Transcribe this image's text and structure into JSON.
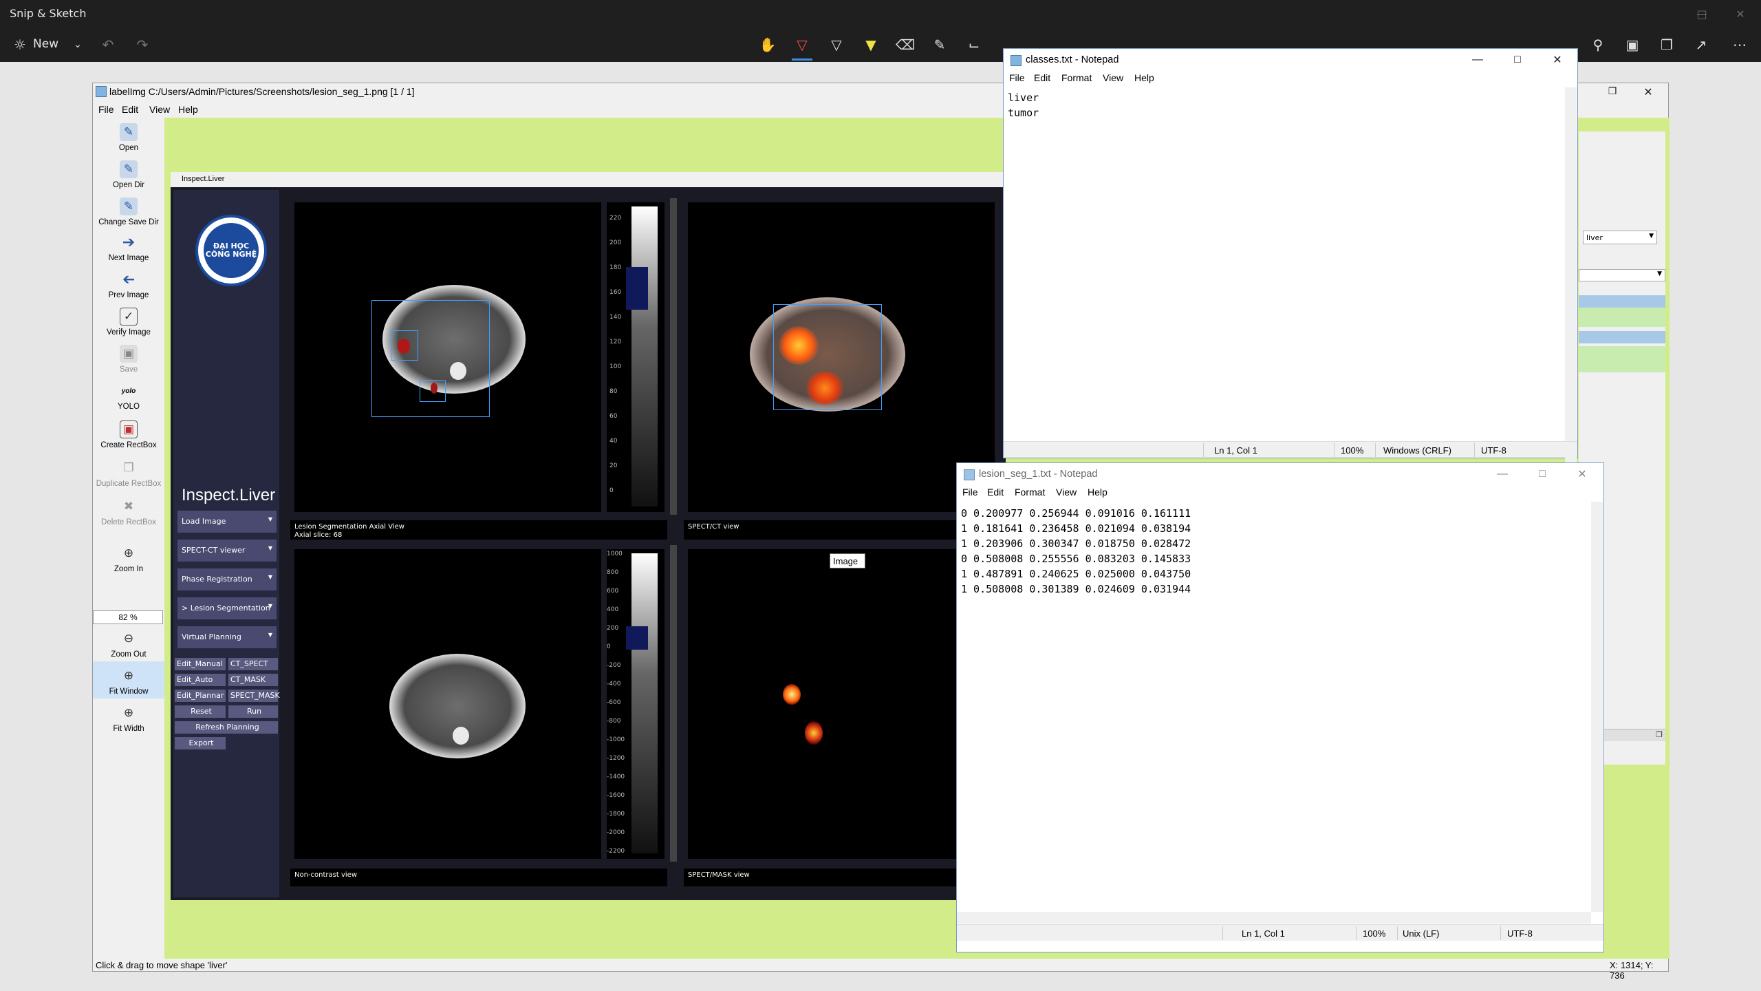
{
  "snip": {
    "title": "Snip & Sketch",
    "new_label": "New"
  },
  "labelimg": {
    "title": "labelImg C:/Users/Admin/Pictures/Screenshots/lesion_seg_1.png [1 / 1]",
    "menu": [
      "File",
      "Edit",
      "View",
      "Help"
    ],
    "tools": {
      "open": "Open",
      "open_dir": "Open Dir",
      "change_save_dir": "Change Save Dir",
      "next_image": "Next Image",
      "prev_image": "Prev Image",
      "verify_image": "Verify Image",
      "save": "Save",
      "yolo_icon": "yolo",
      "yolo": "YOLO",
      "create_rectbox": "Create RectBox",
      "duplicate_rectbox": "Duplicate RectBox",
      "delete_rectbox": "Delete RectBox",
      "zoom_in": "Zoom In",
      "zoom_value": "82 %",
      "zoom_out": "Zoom Out",
      "fit_window": "Fit Window",
      "fit_width": "Fit Width"
    },
    "status_left": "Click & drag to move shape 'liver'",
    "status_right": "X: 1314; Y: 736",
    "label_combo": "liver",
    "tooltip": "Image"
  },
  "inspect": {
    "window_title": "Inspect.Liver",
    "app_title": "Inspect.Liver",
    "logo_text": "ĐẠI HỌC CÔNG NGHỆ",
    "menu": [
      {
        "label": "Load Image"
      },
      {
        "label": "SPECT-CT viewer"
      },
      {
        "label": "Phase Registration"
      },
      {
        "label": "> Lesion Segmentation"
      },
      {
        "label": "Virtual Planning"
      }
    ],
    "buttons": {
      "edit_manual": "Edit_Manual",
      "ct_spect": "CT_SPECT",
      "edit_auto": "Edit_Auto",
      "ct_mask": "CT_MASK",
      "edit_plannar": "Edit_Plannar",
      "spect_mask": "SPECT_MASK",
      "reset": "Reset",
      "run": "Run",
      "refresh_planning": "Refresh Planning",
      "export": "Export"
    },
    "captions": {
      "axial": "Lesion Segmentation Axial View",
      "axial_slice": "Axial slice: 68",
      "spect_ct": "SPECT/CT view",
      "non_contrast": "Non-contrast view",
      "spect_mask": "SPECT/MASK view"
    },
    "scale_top": [
      "220",
      "200",
      "180",
      "160",
      "140",
      "120",
      "100",
      "80",
      "60",
      "40",
      "20",
      "0"
    ],
    "scale_bottom": [
      "1000",
      "800",
      "600",
      "400",
      "200",
      "0",
      "-200",
      "-400",
      "-600",
      "-800",
      "-1000",
      "-1200",
      "-1400",
      "-1600",
      "-1800",
      "-2000",
      "-2200"
    ]
  },
  "notepad_classes": {
    "title": "classes.txt - Notepad",
    "menu": [
      "File",
      "Edit",
      "Format",
      "View",
      "Help"
    ],
    "content": "liver\ntumor",
    "status": {
      "pos": "Ln 1, Col 1",
      "zoom": "100%",
      "eol": "Windows (CRLF)",
      "enc": "UTF-8"
    }
  },
  "notepad_lesion": {
    "title": "lesion_seg_1.txt - Notepad",
    "menu": [
      "File",
      "Edit",
      "Format",
      "View",
      "Help"
    ],
    "content": "0 0.200977 0.256944 0.091016 0.161111\n1 0.181641 0.236458 0.021094 0.038194\n1 0.203906 0.300347 0.018750 0.028472\n0 0.508008 0.255556 0.083203 0.145833\n1 0.487891 0.240625 0.025000 0.043750\n1 0.508008 0.301389 0.024609 0.031944",
    "status": {
      "pos": "Ln 1, Col 1",
      "zoom": "100%",
      "eol": "Unix (LF)",
      "enc": "UTF-8"
    }
  }
}
